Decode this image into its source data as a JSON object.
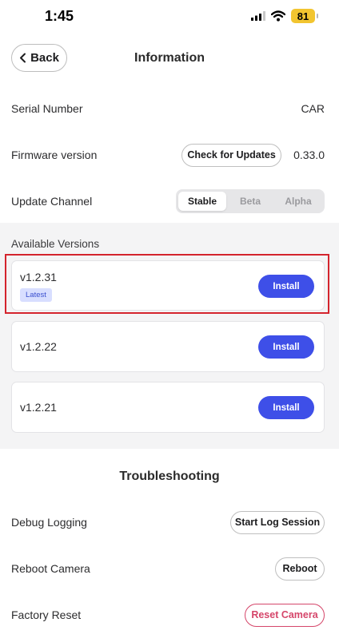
{
  "status_bar": {
    "time": "1:45",
    "battery": "81"
  },
  "header": {
    "back_label": "Back",
    "title": "Information"
  },
  "info": {
    "serial_label": "Serial Number",
    "serial_value": "CAR",
    "firmware_label": "Firmware version",
    "check_updates_label": "Check for Updates",
    "firmware_value": "0.33.0",
    "channel_label": "Update Channel",
    "channels": [
      "Stable",
      "Beta",
      "Alpha"
    ],
    "selected_channel": "Stable"
  },
  "versions": {
    "title": "Available Versions",
    "items": [
      {
        "version": "v1.2.31",
        "badge": "Latest",
        "action": "Install"
      },
      {
        "version": "v1.2.22",
        "action": "Install"
      },
      {
        "version": "v1.2.21",
        "action": "Install"
      }
    ]
  },
  "troubleshooting": {
    "title": "Troubleshooting",
    "debug_label": "Debug Logging",
    "debug_action": "Start Log Session",
    "reboot_label": "Reboot Camera",
    "reboot_action": "Reboot",
    "reset_label": "Factory Reset",
    "reset_action": "Reset Camera"
  },
  "colors": {
    "accent": "#3e4fe8",
    "danger": "#d5466a",
    "highlight": "#d4242d",
    "battery": "#f2c530"
  }
}
